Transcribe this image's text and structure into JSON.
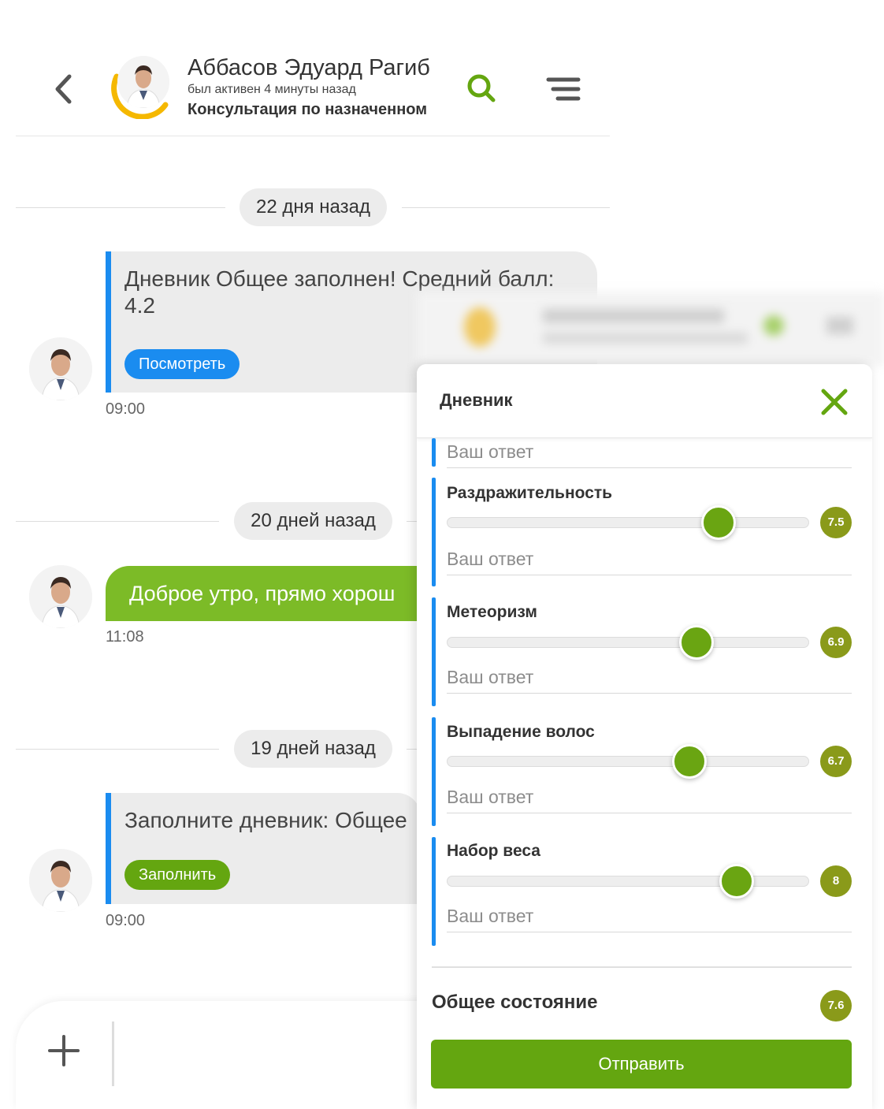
{
  "header": {
    "name": "Аббасов Эдуард Рагиб",
    "status": "был активен 4 минуты назад",
    "topic": "Консультация по назначенном"
  },
  "icons": {
    "back": "chevron-left-icon",
    "search": "search-icon",
    "menu": "menu-icon",
    "close": "close-icon",
    "add": "plus-icon"
  },
  "colors": {
    "accent_green": "#64a610",
    "bubble_green": "#7cbb27",
    "accent_blue": "#1a8cf0",
    "score_olive": "#8a9a1a",
    "ring_yellow": "#f5b800"
  },
  "chat": {
    "separators": [
      {
        "label": "22 дня назад"
      },
      {
        "label": "20 дней назад"
      },
      {
        "label": "19 дней назад"
      }
    ],
    "messages": [
      {
        "text_line1": "Дневник Общее заполнен! Средний балл:",
        "text_line2": "4.2",
        "button": "Посмотреть",
        "time": "09:00"
      },
      {
        "text": "Доброе утро, прямо хорош",
        "time": "11:08"
      },
      {
        "text": "Заполните дневник: Общее",
        "button": "Заполнить",
        "time": "09:00"
      }
    ]
  },
  "diary": {
    "title": "Дневник",
    "top_answer_placeholder": "Ваш ответ",
    "items": [
      {
        "label": "Раздражительность",
        "score": "7.5",
        "value": 7.5,
        "placeholder": "Ваш ответ"
      },
      {
        "label": "Метеоризм",
        "score": "6.9",
        "value": 6.9,
        "placeholder": "Ваш ответ"
      },
      {
        "label": "Выпадение волос",
        "score": "6.7",
        "value": 6.7,
        "placeholder": "Ваш ответ"
      },
      {
        "label": "Набор веса",
        "score": "8",
        "value": 8,
        "placeholder": "Ваш ответ"
      }
    ],
    "total_label": "Общее состояние",
    "total_score": "7.6",
    "submit": "Отправить"
  }
}
